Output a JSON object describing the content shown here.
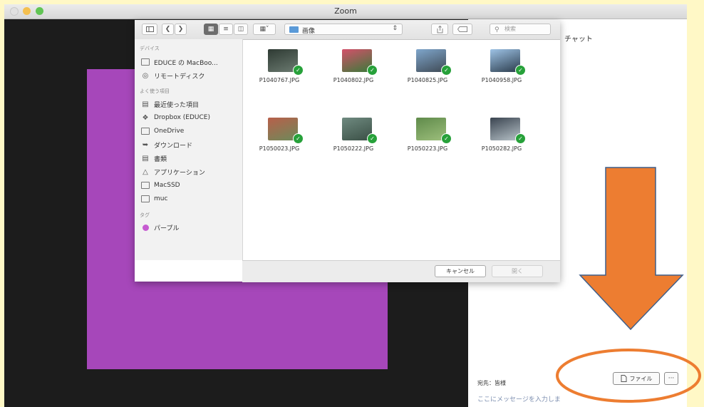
{
  "window": {
    "title": "Zoom"
  },
  "chat": {
    "title": "チャット",
    "to_label": "宛先：皆様",
    "input_placeholder": "ここにメッセージを入力しま",
    "file_button_label": "ファイル",
    "more_button_label": "···"
  },
  "dialog": {
    "location": "画像",
    "search_placeholder": "検索",
    "cancel_label": "キャンセル",
    "open_label": "開く",
    "sidebar": {
      "devices_heading": "デバイス",
      "devices": [
        {
          "label": "EDUCE の MacBoo...",
          "icon": "laptop-icon"
        },
        {
          "label": "リモートディスク",
          "icon": "disc-icon"
        }
      ],
      "favorites_heading": "よく使う項目",
      "favorites": [
        {
          "label": "最近使った項目",
          "icon": "recents-icon"
        },
        {
          "label": "Dropbox (EDUCE)",
          "icon": "dropbox-icon"
        },
        {
          "label": "OneDrive",
          "icon": "folder-icon"
        },
        {
          "label": "ダウンロード",
          "icon": "download-icon"
        },
        {
          "label": "書類",
          "icon": "documents-icon"
        },
        {
          "label": "アプリケーション",
          "icon": "applications-icon"
        },
        {
          "label": "MacSSD",
          "icon": "drive-icon"
        },
        {
          "label": "muc",
          "icon": "folder-icon"
        }
      ],
      "tags_heading": "タグ",
      "tags": [
        {
          "label": "パープル",
          "color": "#c65bd1"
        }
      ]
    },
    "files": [
      {
        "name": "P1040767.JPG",
        "colors": [
          "#2e3a33",
          "#6b7a70"
        ]
      },
      {
        "name": "P1040802.JPG",
        "colors": [
          "#d4506a",
          "#3b7a3a"
        ]
      },
      {
        "name": "P1040825.JPG",
        "colors": [
          "#7fa6cc",
          "#3f4a55"
        ]
      },
      {
        "name": "P1040958.JPG",
        "colors": [
          "#9ec3e6",
          "#2b3c4c"
        ]
      },
      {
        "name": "P1050023.JPG",
        "colors": [
          "#b85f4a",
          "#6d8a5a"
        ]
      },
      {
        "name": "P1050222.JPG",
        "colors": [
          "#6f8a80",
          "#3a4f45"
        ]
      },
      {
        "name": "P1050223.JPG",
        "colors": [
          "#5f8a4a",
          "#9dbf7c"
        ]
      },
      {
        "name": "P1050282.JPG",
        "colors": [
          "#3a4450",
          "#b7c2c8"
        ]
      }
    ]
  },
  "annotation": {
    "arrow_color": "#ed7d31",
    "arrow_outline": "#3f5f8a",
    "ellipse_color": "#ed7d31"
  },
  "page_background": "#fff8c6"
}
